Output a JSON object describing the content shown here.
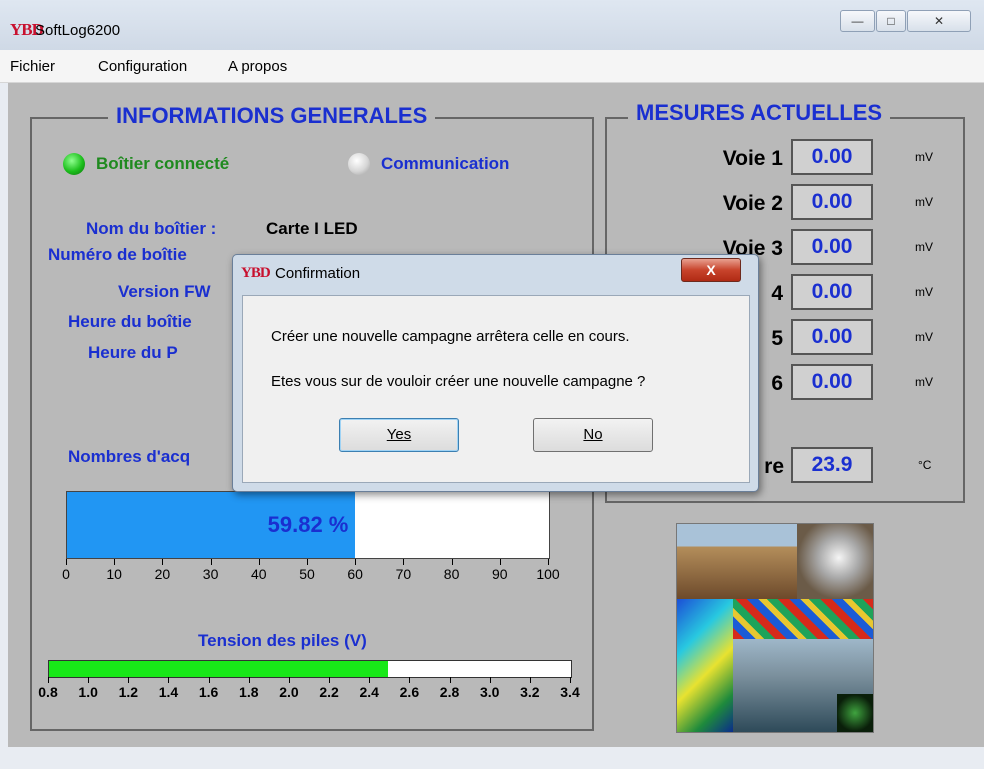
{
  "window": {
    "title": "SoftLog6200",
    "icon_text": "YBD"
  },
  "menu": {
    "items": [
      "Fichier",
      "Configuration",
      "A propos"
    ]
  },
  "info": {
    "title": "INFORMATIONS GENERALES",
    "status_connected": "Boîtier connecté",
    "status_comm": "Communication",
    "labels": [
      "Nom du boîtier :",
      "Numéro de boîtie",
      "Version FW",
      "Heure du boîtie",
      "Heure du P"
    ],
    "box_name": "Carte I LED",
    "acq_label": "Nombres d'acq",
    "progress_text": "59.82 %",
    "progress_value": 59.82,
    "progress_ticks": [
      "0",
      "10",
      "20",
      "30",
      "40",
      "50",
      "60",
      "70",
      "80",
      "90",
      "100"
    ],
    "battery_label": "Tension des piles (V)",
    "battery_fraction": 0.65,
    "battery_ticks": [
      "0.8",
      "1.0",
      "1.2",
      "1.4",
      "1.6",
      "1.8",
      "2.0",
      "2.2",
      "2.4",
      "2.6",
      "2.8",
      "3.0",
      "3.2",
      "3.4"
    ]
  },
  "mesures": {
    "title": "MESURES ACTUELLES",
    "channels": [
      {
        "label": "Voie 1",
        "value": "0.00",
        "unit": "mV"
      },
      {
        "label": "Voie 2",
        "value": "0.00",
        "unit": "mV"
      },
      {
        "label": "Voie 3",
        "value": "0.00",
        "unit": "mV"
      },
      {
        "label": "4",
        "value": "0.00",
        "unit": "mV"
      },
      {
        "label": "5",
        "value": "0.00",
        "unit": "mV"
      },
      {
        "label": "6",
        "value": "0.00",
        "unit": "mV"
      }
    ],
    "temp_label": "re",
    "temp_value": "23.9",
    "temp_unit": "°C"
  },
  "dialog": {
    "title": "Confirmation",
    "message1": "Créer une nouvelle campagne arrêtera celle en cours.",
    "message2": "Etes vous sur de vouloir créer une nouvelle campagne ?",
    "yes_label": "Yes",
    "no_label": "No",
    "close_label": "X"
  },
  "colors": {
    "progress": "#2196f3",
    "battery": "#18e818",
    "accent_blue": "#1a2fd0",
    "connected_green": "#1f8a1f"
  }
}
